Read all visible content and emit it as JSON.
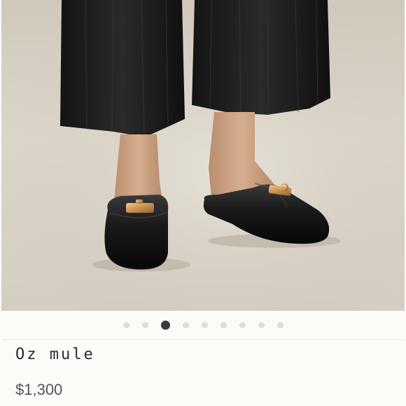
{
  "product": {
    "name": "Oz mule",
    "price": "$1,300"
  },
  "gallery": {
    "total_images": 9,
    "active_index": 2
  },
  "colors": {
    "background": "#fdfbf8",
    "dot_inactive": "#dddddd",
    "dot_active": "#3a3a3a"
  },
  "icons": {
    "carousel_dot": "circle"
  }
}
